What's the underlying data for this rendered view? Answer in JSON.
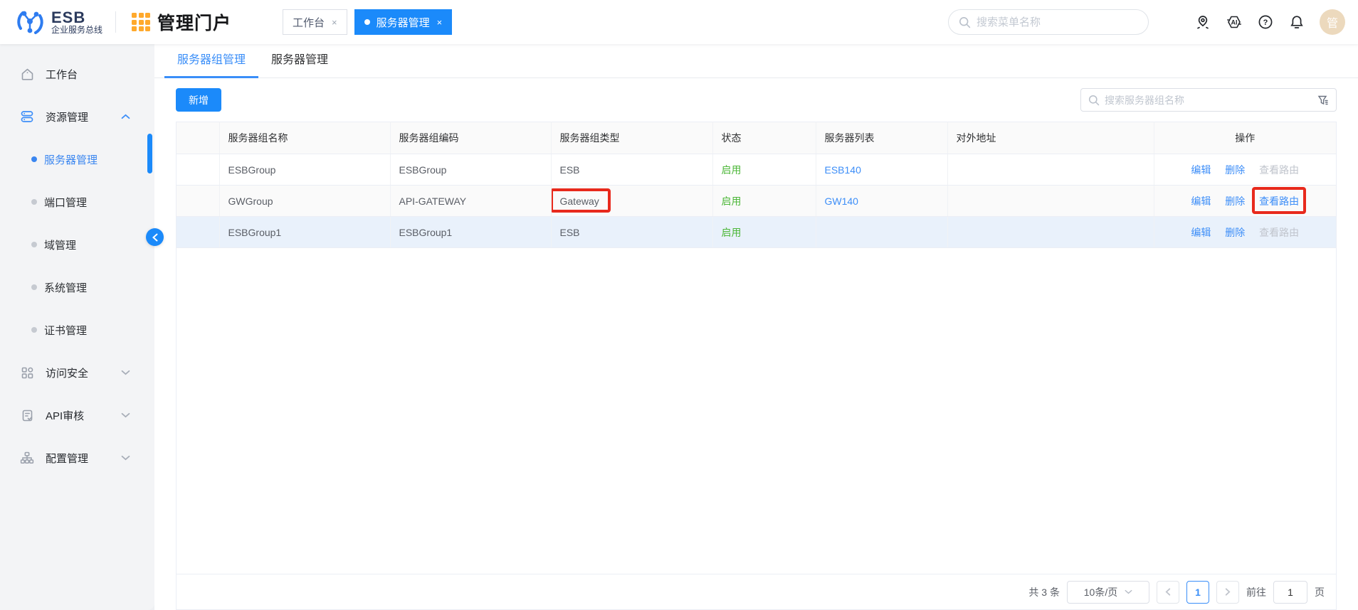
{
  "brand": {
    "logo_icon": "esb-network-icon",
    "name": "ESB",
    "subtitle": "企业服务总线"
  },
  "portal": {
    "icon": "app-grid-icon",
    "title": "管理门户"
  },
  "top_tabs": [
    {
      "label": "工作台",
      "active": false
    },
    {
      "label": "服务器管理",
      "active": true
    }
  ],
  "global_search": {
    "icon": "search-icon",
    "placeholder": "搜索菜单名称"
  },
  "topbar": {
    "icons": [
      "location-pin-icon",
      "ai-assistant-icon",
      "help-icon",
      "notification-bell-icon"
    ],
    "avatar_text": "管"
  },
  "sidebar": {
    "items": [
      {
        "icon": "home-icon",
        "label": "工作台"
      },
      {
        "icon": "server-stack-icon",
        "label": "资源管理",
        "expanded": true,
        "children": [
          {
            "label": "服务器管理",
            "active": true
          },
          {
            "label": "端口管理"
          },
          {
            "label": "域管理"
          },
          {
            "label": "系统管理"
          },
          {
            "label": "证书管理"
          }
        ]
      },
      {
        "icon": "squares-grid-icon",
        "label": "访问安全",
        "expanded": false
      },
      {
        "icon": "doc-check-icon",
        "label": "API审核",
        "expanded": false
      },
      {
        "icon": "sitemap-icon",
        "label": "配置管理",
        "expanded": false
      }
    ]
  },
  "content": {
    "tabs": [
      {
        "label": "服务器组管理",
        "active": true
      },
      {
        "label": "服务器管理",
        "active": false
      }
    ],
    "add_button_label": "新增",
    "table_search": {
      "placeholder": "搜索服务器组名称",
      "filter_icon": "funnel-icon"
    },
    "table": {
      "columns": [
        "",
        "服务器组名称",
        "服务器组编码",
        "服务器组类型",
        "状态",
        "服务器列表",
        "对外地址",
        "操作"
      ],
      "action_labels": {
        "edit": "编辑",
        "delete": "删除",
        "view_route": "查看路由"
      },
      "rows": [
        {
          "status_dot": "green",
          "name": "ESBGroup",
          "code": "ESBGroup",
          "type": "ESB",
          "status": "启用",
          "servers": "ESB140",
          "address": "",
          "view_route_enabled": false,
          "annotated": false,
          "selected": false
        },
        {
          "status_dot": "green",
          "name": "GWGroup",
          "code": "API-GATEWAY",
          "type": "Gateway",
          "status": "启用",
          "servers": "GW140",
          "address": "",
          "view_route_enabled": true,
          "annotated": true,
          "selected": false
        },
        {
          "status_dot": "green",
          "name": "ESBGroup1",
          "code": "ESBGroup1",
          "type": "ESB",
          "status": "启用",
          "servers": "",
          "address": "",
          "view_route_enabled": false,
          "annotated": false,
          "selected": true
        }
      ]
    },
    "pagination": {
      "total": "共 3 条",
      "page_size": "10条/页",
      "current_page": "1",
      "goto_label": "前往",
      "goto_value": "1",
      "page_unit": "页"
    }
  },
  "annotations": {
    "color": "#e8291c",
    "targets": [
      "row-2-server-group-type-cell",
      "row-2-view-route-link"
    ]
  },
  "colors": {
    "primary": "#1b8afa",
    "link": "#3d8ef8",
    "success_text": "#4cb738",
    "selected_row_bg": "#e9f1fb",
    "sidebar_bg": "#f3f4f6"
  }
}
